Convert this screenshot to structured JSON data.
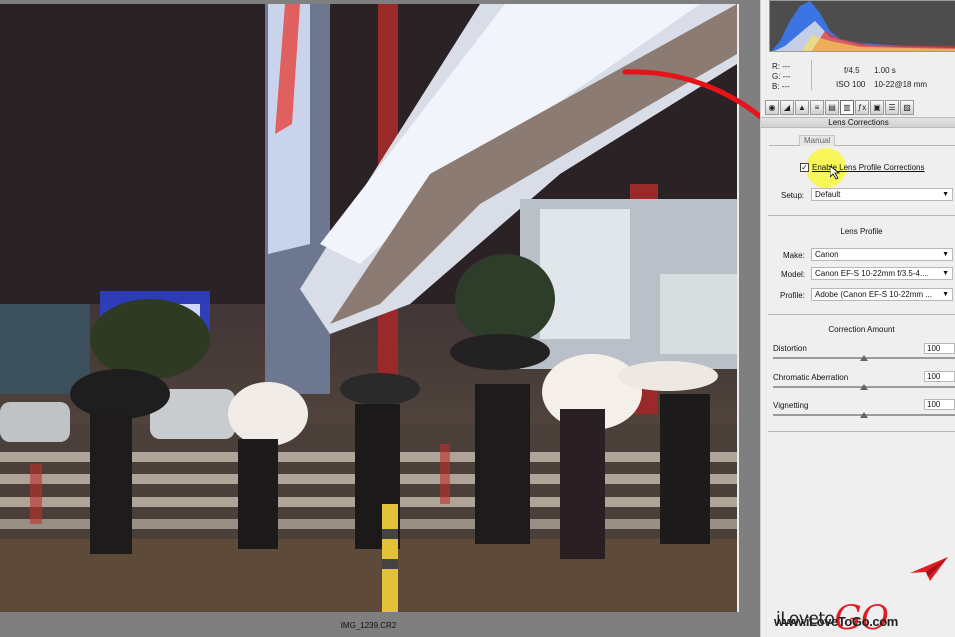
{
  "canvas": {
    "filename": "IMG_1239.CR2"
  },
  "histogram": {
    "r": "R:   ---",
    "g": "G:   ---",
    "b": "B:   ---",
    "aperture": "f/4.5",
    "shutter": "1.00 s",
    "iso": "ISO 100",
    "lens": "10-22@18 mm"
  },
  "panel": {
    "title": "Lens Corrections",
    "subtabs": [
      "Manual"
    ],
    "tab_icons": [
      "camera-raw-basic-icon",
      "tone-curve-icon",
      "detail-icon",
      "hsl-icon",
      "split-toning-icon",
      "lens-corrections-icon",
      "effects-icon",
      "camera-calibration-icon",
      "presets-icon",
      "snapshots-icon"
    ],
    "enable_profile": {
      "label": "Enable Lens Profile Corrections",
      "checked": true
    },
    "setup": {
      "label": "Setup:",
      "value": "Default"
    },
    "lens_profile": {
      "heading": "Lens Profile",
      "make": {
        "label": "Make:",
        "value": "Canon"
      },
      "model": {
        "label": "Model:",
        "value": "Canon EF-S 10-22mm f/3.5-4...."
      },
      "profile": {
        "label": "Profile:",
        "value": "Adobe (Canon EF-S 10-22mm ..."
      }
    },
    "correction_amount": {
      "heading": "Correction Amount",
      "distortion": {
        "label": "Distortion",
        "value": "100",
        "level": 100
      },
      "chromatic_aberration": {
        "label": "Chromatic Aberration",
        "value": "100",
        "level": 100
      },
      "vignetting": {
        "label": "Vignetting",
        "value": "100",
        "level": 100
      }
    }
  },
  "watermark": {
    "wordmark_prefix": "iLoveto",
    "wordmark_go": "GO",
    "url": "www.iLoveToGo.com",
    "accent_color": "#e31b23"
  },
  "annotation": {
    "arrow_color": "#e8121b",
    "highlight_color": "#f8f02a"
  }
}
